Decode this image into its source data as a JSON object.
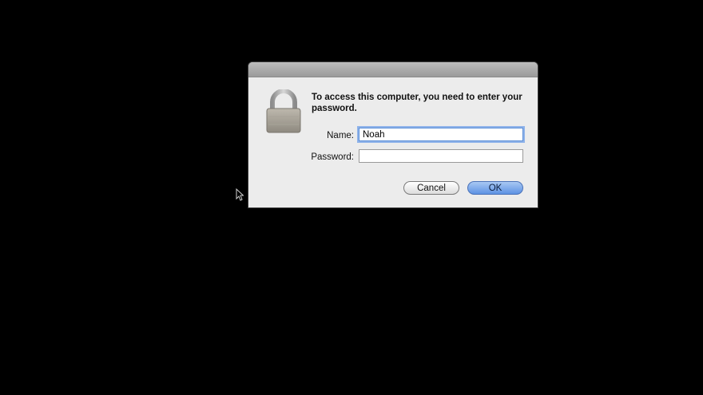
{
  "dialog": {
    "message": "To access this computer, you need to enter your password.",
    "name_label": "Name:",
    "name_value": "Noah",
    "password_label": "Password:",
    "password_value": "",
    "cancel_label": "Cancel",
    "ok_label": "OK"
  },
  "icons": {
    "lock": "lock-icon",
    "cursor": "mouse-pointer-icon"
  },
  "colors": {
    "background": "#000000",
    "dialog_bg": "#ececec",
    "focus_ring": "#8fb3ea",
    "default_button": "#5d92e3"
  }
}
